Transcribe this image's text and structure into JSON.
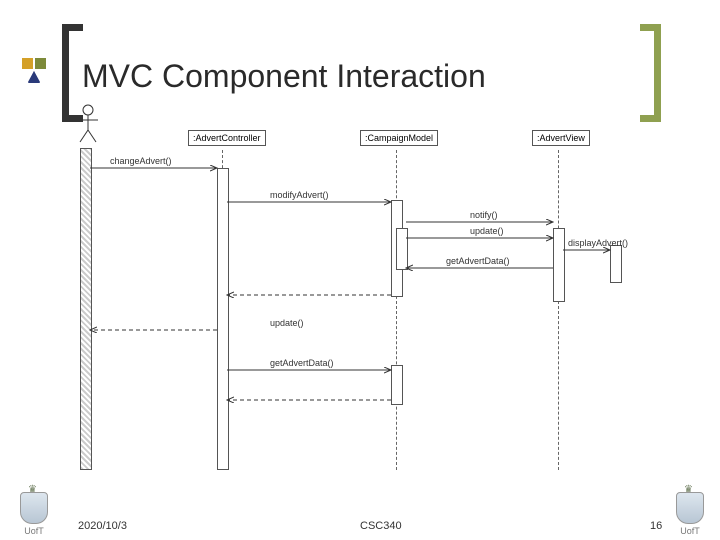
{
  "title": "MVC Component Interaction",
  "footer": {
    "date": "2020/10/3",
    "course": "CSC340",
    "page": "16"
  },
  "logo_label": "UofT",
  "lifelines": {
    "controller": ":AdvertController",
    "model": ":CampaignModel",
    "view": ":AdvertView"
  },
  "messages": {
    "changeAdvert": "changeAdvert()",
    "modifyAdvert": "modifyAdvert()",
    "notify": "notify()",
    "update": "update()",
    "getAdvertData": "getAdvertData()",
    "displayAdvert": "displayAdvert()",
    "update2": "update()",
    "getAdvertData2": "getAdvertData()"
  }
}
